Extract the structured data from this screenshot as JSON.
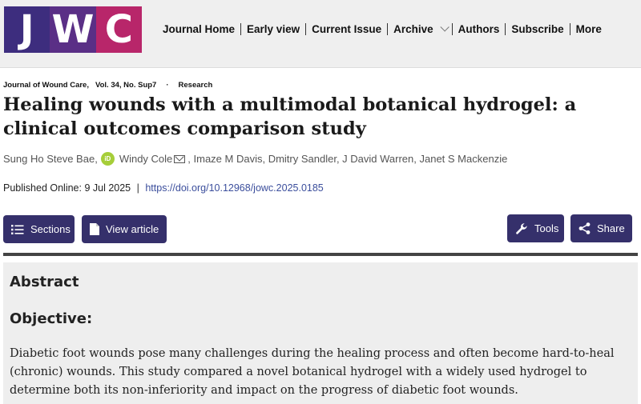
{
  "logo": {
    "letters": [
      "J",
      "W",
      "C"
    ]
  },
  "nav": {
    "items": [
      "Journal Home",
      "Early view",
      "Current Issue",
      "Archive",
      "Authors",
      "Subscribe",
      "More"
    ]
  },
  "article": {
    "journal": "Journal of Wound Care,",
    "volume": "Vol. 34, No. Sup7",
    "dot": "·",
    "type": "Research",
    "title": "Healing wounds with a multimodal botanical hydrogel: a clinical outcomes comparison study",
    "authors": {
      "a1": "Sung Ho Steve Bae,",
      "orcid": "iD",
      "a2": "Windy Cole",
      "rest": ", Imaze M Davis, Dmitry Sandler, J David Warren, Janet S Mackenzie"
    },
    "published": "Published Online: 9 Jul 2025",
    "sep": "|",
    "doi": "https://doi.org/10.12968/jowc.2025.0185"
  },
  "buttons": {
    "sections": "Sections",
    "view_article": "View article",
    "tools": "Tools",
    "share": "Share"
  },
  "abstract": {
    "heading": "Abstract",
    "objective_heading": "Objective:",
    "objective_text": "Diabetic foot wounds pose many challenges during the healing process and often become hard-to-heal (chronic) wounds. This study compared a novel botanical hydrogel with a widely used hydrogel to determine both its non-inferiority and impact on the progress of diabetic foot wounds."
  },
  "colors": {
    "button_bg": "#35306b",
    "logo_j": "#3d2d7e",
    "logo_w": "#5a2f86",
    "logo_c": "#b8266a",
    "doi_link": "#3b4e9c",
    "orcid": "#a6ce39"
  }
}
